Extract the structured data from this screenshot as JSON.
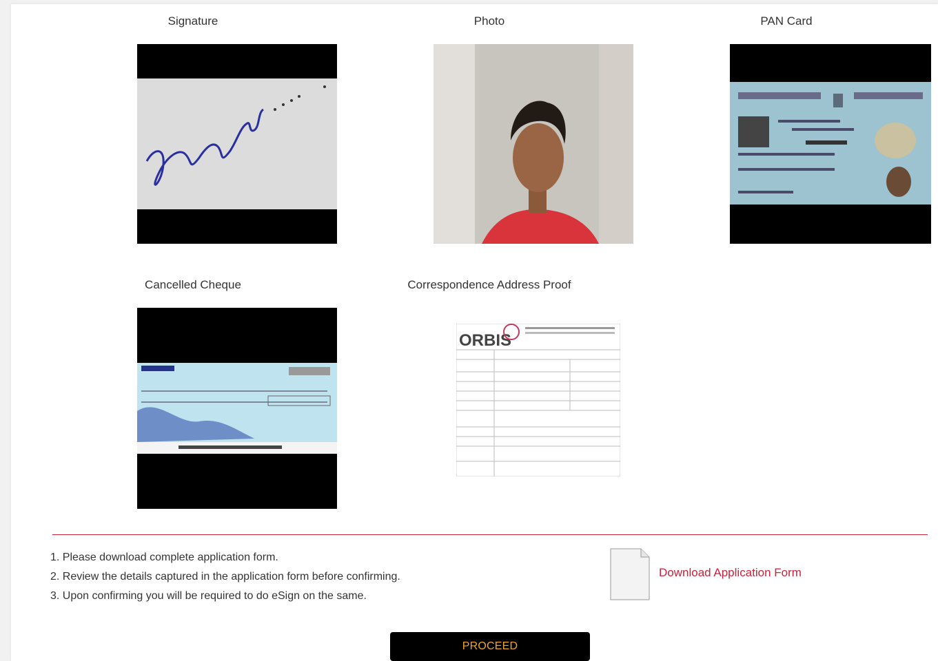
{
  "documents": [
    {
      "label": "Signature",
      "image": "signature-image"
    },
    {
      "label": "Photo",
      "image": "person-photo-image"
    },
    {
      "label": "PAN Card",
      "image": "pan-card-image"
    },
    {
      "label": "Cancelled Cheque",
      "image": "cheque-image"
    },
    {
      "label": "Correspondence Address Proof",
      "image": "address-proof-document-image"
    }
  ],
  "instructions": [
    "1. Please download complete application form.",
    "2. Review the details captured in the application form before confirming.",
    "3. Upon confirming you will be required to do eSign on the same."
  ],
  "download": {
    "label": "Download Application Form",
    "icon": "file-icon"
  },
  "proceed_label": "PROCEED",
  "colors": {
    "accent": "#c9213b",
    "button_bg": "#000000",
    "button_text": "#f0a52a"
  }
}
